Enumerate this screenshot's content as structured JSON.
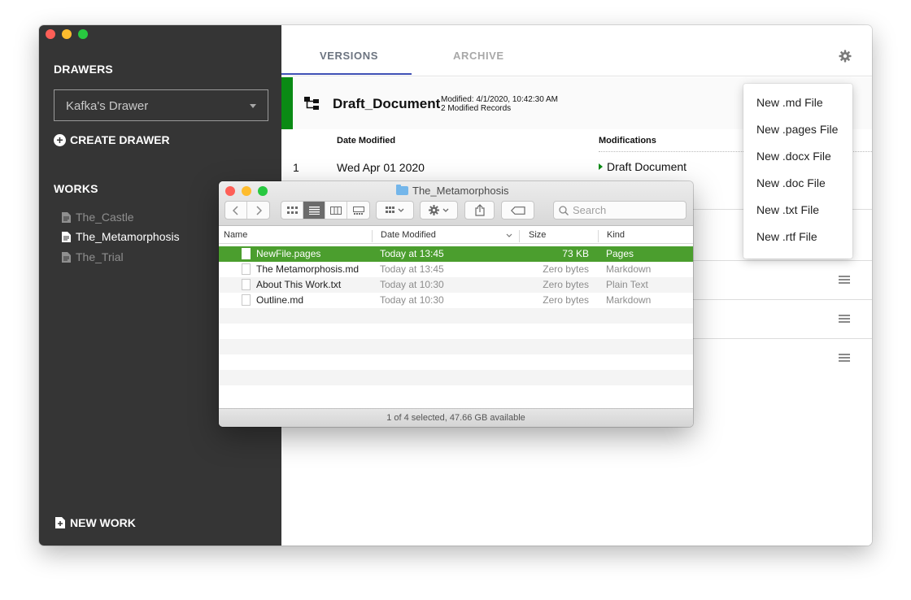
{
  "sidebar": {
    "drawers_heading": "DRAWERS",
    "drawer_select_value": "Kafka's Drawer",
    "create_drawer_label": "CREATE DRAWER",
    "works_heading": "WORKS",
    "works": [
      {
        "label": "The_Castle",
        "active": false
      },
      {
        "label": "The_Metamorphosis",
        "active": true
      },
      {
        "label": "The_Trial",
        "active": false
      }
    ],
    "new_work_label": "NEW WORK"
  },
  "main": {
    "tabs": [
      {
        "label": "VERSIONS",
        "selected": true
      },
      {
        "label": "ARCHIVE",
        "selected": false
      }
    ],
    "document": {
      "title": "Draft_Document",
      "modified": "Modified: 4/1/2020, 10:42:30 AM",
      "records": "2 Modified Records"
    },
    "columns": {
      "date_modified": "Date Modified",
      "modifications": "Modifications"
    },
    "rows": [
      {
        "num": "1",
        "date": "Wed Apr 01 2020",
        "modification": "Draft Document"
      }
    ]
  },
  "new_file_menu": {
    "items": [
      "New .md File",
      "New .pages File",
      "New .docx File",
      "New .doc File",
      "New .txt File",
      "New .rtf File"
    ]
  },
  "finder": {
    "title": "The_Metamorphosis",
    "search_placeholder": "Search",
    "columns": {
      "name": "Name",
      "date_modified": "Date Modified",
      "size": "Size",
      "kind": "Kind"
    },
    "files": [
      {
        "name": "NewFile.pages",
        "date": "Today at 13:45",
        "size": "73 KB",
        "kind": "Pages",
        "selected": true
      },
      {
        "name": "The Metamorphosis.md",
        "date": "Today at 13:45",
        "size": "Zero bytes",
        "kind": "Markdown",
        "selected": false
      },
      {
        "name": "About This Work.txt",
        "date": "Today at 10:30",
        "size": "Zero bytes",
        "kind": "Plain Text",
        "selected": false
      },
      {
        "name": "Outline.md",
        "date": "Today at 10:30",
        "size": "Zero bytes",
        "kind": "Markdown",
        "selected": false
      }
    ],
    "status": "1 of 4 selected, 47.66 GB available"
  },
  "colors": {
    "sidebar_bg": "#353535",
    "accent_green": "#0a8a14",
    "finder_selection": "#4b9e2e",
    "tab_underline": "#3f51b5"
  }
}
